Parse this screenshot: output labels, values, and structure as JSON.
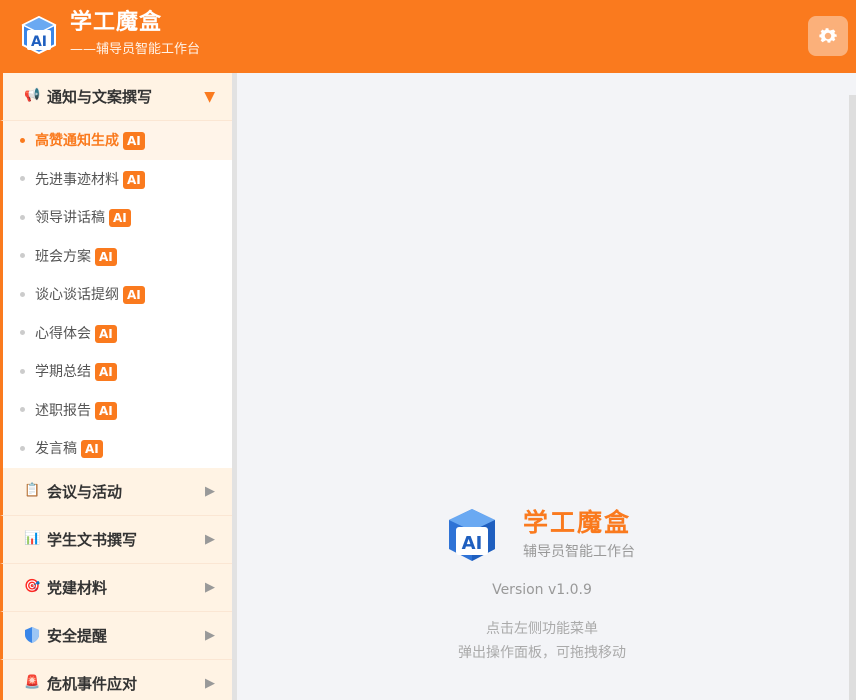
{
  "header": {
    "title": "学工魔盒",
    "subtitle": "——辅导员智能工作台",
    "logo_text": "AI",
    "settings_icon": "gear-icon"
  },
  "sidebar": {
    "groups": [
      {
        "label": "通知与文案撰写",
        "icon": "megaphone-icon",
        "expanded": true
      },
      {
        "label": "会议与活动",
        "icon": "clipboard-icon",
        "expanded": false
      },
      {
        "label": "学生文书撰写",
        "icon": "bar-chart-icon",
        "expanded": false
      },
      {
        "label": "党建材料",
        "icon": "target-icon",
        "expanded": false
      },
      {
        "label": "安全提醒",
        "icon": "shield-icon",
        "expanded": false
      },
      {
        "label": "危机事件应对",
        "icon": "siren-icon",
        "expanded": false
      }
    ],
    "sub_items": [
      {
        "label": "高赞通知生成",
        "badge": "AI",
        "active": true
      },
      {
        "label": "先进事迹材料",
        "badge": "AI"
      },
      {
        "label": "领导讲话稿",
        "badge": "AI"
      },
      {
        "label": "班会方案",
        "badge": "AI"
      },
      {
        "label": "谈心谈话提纲",
        "badge": "AI"
      },
      {
        "label": "心得体会",
        "badge": "AI"
      },
      {
        "label": "学期总结",
        "badge": "AI"
      },
      {
        "label": "述职报告",
        "badge": "AI"
      },
      {
        "label": "发言稿",
        "badge": "AI"
      }
    ]
  },
  "main": {
    "title": "学工魔盒",
    "subtitle": "辅导员智能工作台",
    "version": "Version v1.0.9",
    "hint_line1": "点击左侧功能菜单",
    "hint_line2": "弹出操作面板，可拖拽移动"
  },
  "colors": {
    "accent": "#fa7a1e",
    "badge_bg": "#fa7a1e",
    "logo_blue": "#2f73d6"
  }
}
